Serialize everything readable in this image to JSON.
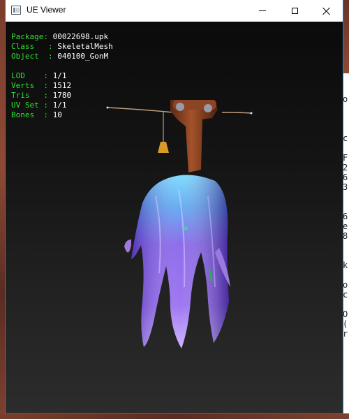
{
  "window": {
    "title": "UE Viewer",
    "icon": "app-window-icon"
  },
  "info": {
    "package": {
      "key": "Package",
      "value": "00022698.upk"
    },
    "class": {
      "key": "Class",
      "value": "SkeletalMesh"
    },
    "object": {
      "key": "Object",
      "value": "040100_GonM"
    },
    "lod": {
      "key": "LOD",
      "value": "1/1"
    },
    "verts": {
      "key": "Verts",
      "value": "1512"
    },
    "tris": {
      "key": "Tris",
      "value": "1780"
    },
    "uvset": {
      "key": "UV Set",
      "value": "1/1"
    },
    "bones": {
      "key": "Bones",
      "value": "10"
    }
  },
  "background_window_chars": [
    "o",
    "",
    "c",
    "",
    "F",
    "2",
    "6",
    "3",
    "",
    "6",
    "e",
    "8",
    "",
    "k",
    "",
    "o",
    "c",
    "",
    "O",
    "(",
    "r"
  ],
  "colors": {
    "label_green": "#33dd33",
    "value_white": "#ffffff",
    "viewport_top": "#0b0b0b",
    "viewport_bottom": "#2c2c2c"
  }
}
